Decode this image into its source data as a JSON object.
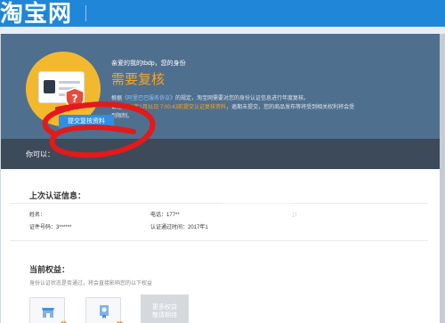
{
  "header": {
    "logo_text": "淘宝网"
  },
  "banner": {
    "greeting": "亲爱的我的tbdp，您的身份",
    "status": "需要复核",
    "desc_pre": "根据",
    "desc_link": "《阿里巴巴服务协议》",
    "desc_mid": "的规定，淘宝网需要对您的身份认证信息进行年度复核。",
    "desc_line2_pre": "请在",
    "desc_deadline": "2018年1月31日 7:00:43前提交认证复核资料",
    "desc_line2_post": "，逾期未提交，您的商品发布等将受到相关权利将会受",
    "desc_line3": "到限制。"
  },
  "actions": {
    "label": "你可以：",
    "submit_button": "提交复核资料"
  },
  "last_cert": {
    "title": "上次认证信息：",
    "name_label": "姓名：",
    "phone_label": "电话：",
    "phone_value": "177**",
    "address_label": "地址：",
    "id_label": "证件号码：",
    "id_value": "3******",
    "cert_time_label": "认证通过时间：",
    "cert_time_value": "2017年1"
  },
  "rights": {
    "title": "当前权益：",
    "subtitle": "身份认证状态是否通过，将会直接影响您的以下权益",
    "more_line1": "更多权益",
    "more_line2": "敬请期待"
  },
  "colors": {
    "primary": "#1f86d8",
    "banner": "#4f6f8e",
    "action_bar": "#3c4a5a",
    "warning": "#f5a623",
    "marker": "#e11a1a"
  },
  "icons": [
    "id-card-icon",
    "shield-warning-icon",
    "shop-icon",
    "certificate-icon"
  ]
}
